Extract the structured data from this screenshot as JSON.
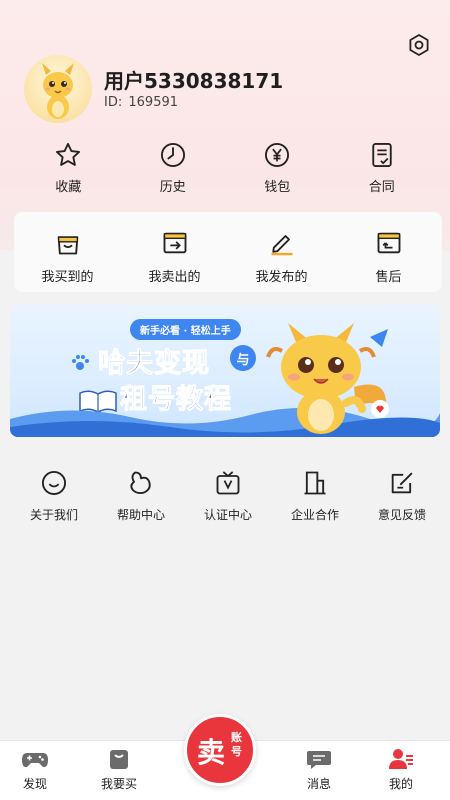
{
  "profile": {
    "username": "用户5330838171",
    "id_prefix": "ID:",
    "id_value": "169591"
  },
  "quick_actions": [
    {
      "label": "收藏",
      "icon": "star-icon"
    },
    {
      "label": "历史",
      "icon": "clock-icon"
    },
    {
      "label": "钱包",
      "icon": "wallet-yen-icon"
    },
    {
      "label": "合同",
      "icon": "contract-icon"
    }
  ],
  "orders": [
    {
      "label": "我买到的",
      "icon": "bag-icon"
    },
    {
      "label": "我卖出的",
      "icon": "box-arrow-icon"
    },
    {
      "label": "我发布的",
      "icon": "pen-icon"
    },
    {
      "label": "售后",
      "icon": "return-box-icon"
    }
  ],
  "banner": {
    "pill": "新手必看 · 轻松上手",
    "title_line1": "哈夫变现",
    "title_line2": "租号教程",
    "connector": "与"
  },
  "services": [
    {
      "label": "关于我们",
      "icon": "smile-icon"
    },
    {
      "label": "帮助中心",
      "icon": "help-icon"
    },
    {
      "label": "认证中心",
      "icon": "verify-tv-icon"
    },
    {
      "label": "企业合作",
      "icon": "building-icon"
    },
    {
      "label": "意见反馈",
      "icon": "feedback-icon"
    }
  ],
  "tabbar": {
    "discover": "发现",
    "buy": "我要买",
    "sell_big": "卖",
    "sell_small": "账号",
    "messages": "消息",
    "mine": "我的"
  },
  "colors": {
    "accent_red": "#e9363d",
    "banner_blue": "#3e86f0",
    "header_pink": "#fdecec"
  }
}
